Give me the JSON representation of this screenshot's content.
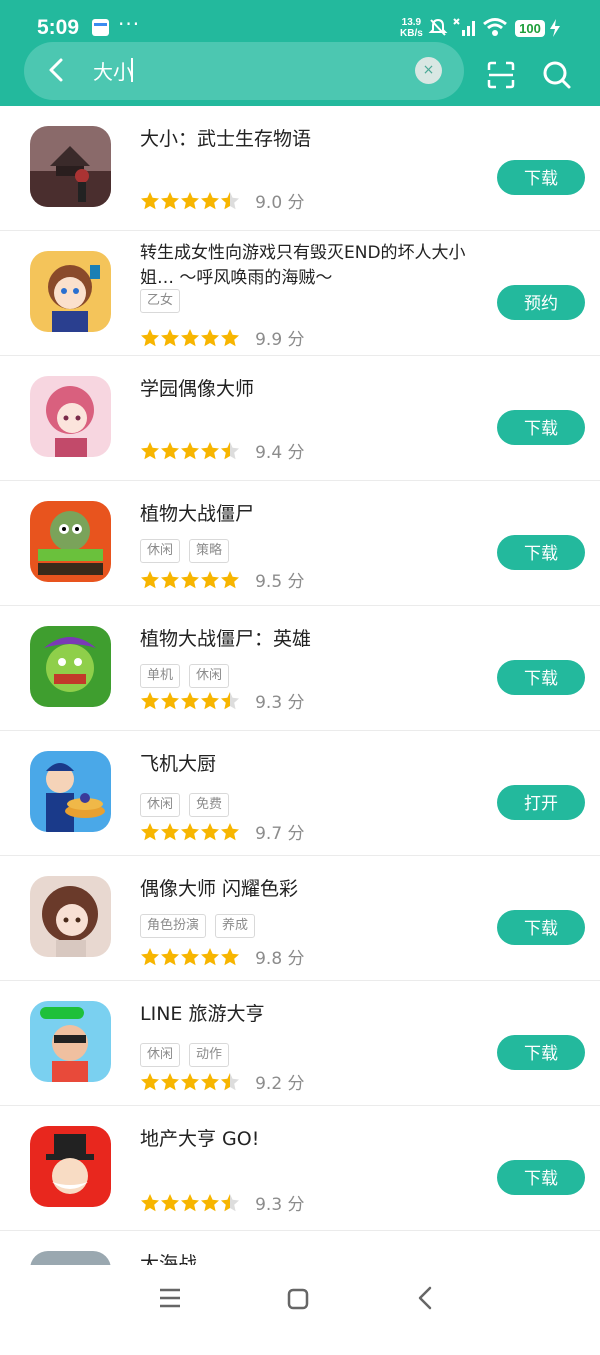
{
  "status_bar": {
    "time": "5:09",
    "more": "···",
    "net_speed_value": "13.9",
    "net_speed_unit": "KB/s",
    "battery": "100"
  },
  "search": {
    "query": "大小",
    "clear_symbol": "×"
  },
  "colors": {
    "brand": "#23b99d",
    "star": "#f7b500",
    "star_empty": "#dddddd"
  },
  "apps": [
    {
      "name": "大小：武士生存物语",
      "tags": [],
      "rating": 4.5,
      "score": "9.0 分",
      "action": "下载"
    },
    {
      "name": "转生成女性向游戏只有毁灭END的坏人大小姐… ～呼风唤雨的海贼～",
      "tags": [
        "乙女"
      ],
      "rating": 5,
      "score": "9.9 分",
      "action": "预约"
    },
    {
      "name": "学园偶像大师",
      "tags": [],
      "rating": 4.5,
      "score": "9.4 分",
      "action": "下载"
    },
    {
      "name": "植物大战僵尸",
      "tags": [
        "休闲",
        "策略"
      ],
      "rating": 5,
      "score": "9.5 分",
      "action": "下载"
    },
    {
      "name": "植物大战僵尸：英雄",
      "tags": [
        "单机",
        "休闲"
      ],
      "rating": 4.5,
      "score": "9.3 分",
      "action": "下载"
    },
    {
      "name": "飞机大厨",
      "tags": [
        "休闲",
        "免费"
      ],
      "rating": 5,
      "score": "9.7 分",
      "action": "打开"
    },
    {
      "name": "偶像大师 闪耀色彩",
      "tags": [
        "角色扮演",
        "养成"
      ],
      "rating": 5,
      "score": "9.8 分",
      "action": "下载"
    },
    {
      "name": "LINE 旅游大亨",
      "tags": [
        "休闲",
        "动作"
      ],
      "rating": 4.5,
      "score": "9.2 分",
      "action": "下载"
    },
    {
      "name": "地产大亨 GO!",
      "tags": [],
      "rating": 4.5,
      "score": "9.3 分",
      "action": "下载"
    },
    {
      "name": "大海战",
      "tags": [],
      "rating": null,
      "score": "",
      "action": ""
    }
  ],
  "icons": {
    "back": "arrow-left-icon",
    "scan": "scan-icon",
    "search": "search-icon",
    "nav_menu": "menu-icon",
    "nav_home": "home-square-icon",
    "nav_back": "chevron-left-icon"
  }
}
